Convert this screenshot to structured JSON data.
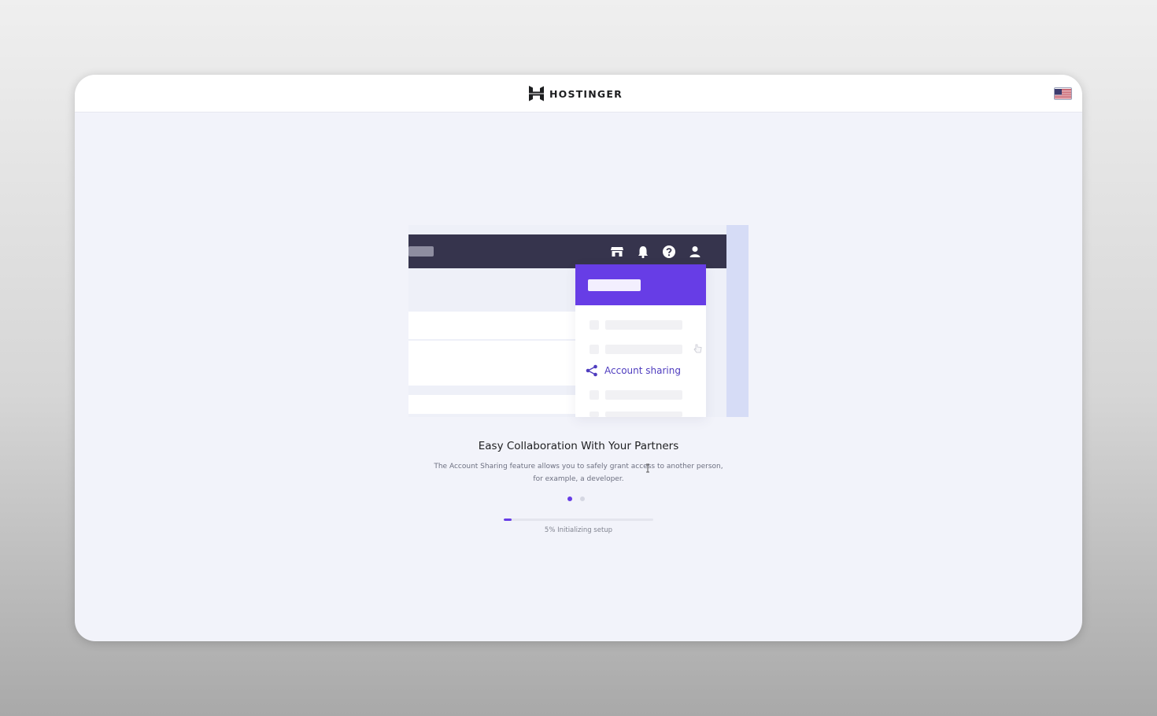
{
  "header": {
    "brand_name": "HOSTINGER",
    "language_flag": "us-flag-icon"
  },
  "illustration": {
    "toolbar_icons": [
      "store-icon",
      "bell-icon",
      "help-icon",
      "user-icon"
    ],
    "menu_item_label": "Account sharing",
    "menu_item_icon": "share-icon"
  },
  "onboarding": {
    "title": "Easy Collaboration With Your Partners",
    "description_line1": "The Account Sharing feature allows you to safely grant access to another person,",
    "description_line2": "for example, a developer.",
    "slide_count": 2,
    "active_slide": 1
  },
  "progress": {
    "percent": 5,
    "status_text": "5% Initializing setup"
  },
  "colors": {
    "accent": "#673de6",
    "dark_bar": "#36344d",
    "side_panel": "#d6dcf6"
  }
}
